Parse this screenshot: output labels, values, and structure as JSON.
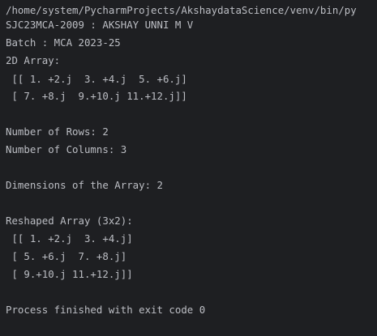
{
  "console": {
    "lines": [
      "/home/system/PycharmProjects/AkshaydataScience/venv/bin/py",
      "SJC23MCA-2009 : AKSHAY UNNI M V",
      "Batch : MCA 2023-25",
      "2D Array:",
      " [[ 1. +2.j  3. +4.j  5. +6.j]",
      " [ 7. +8.j  9.+10.j 11.+12.j]]",
      "",
      "Number of Rows: 2",
      "Number of Columns: 3",
      "",
      "Dimensions of the Array: 2",
      "",
      "Reshaped Array (3x2):",
      " [[ 1. +2.j  3. +4.j]",
      " [ 5. +6.j  7. +8.j]",
      " [ 9.+10.j 11.+12.j]]",
      "",
      "Process finished with exit code 0"
    ]
  }
}
